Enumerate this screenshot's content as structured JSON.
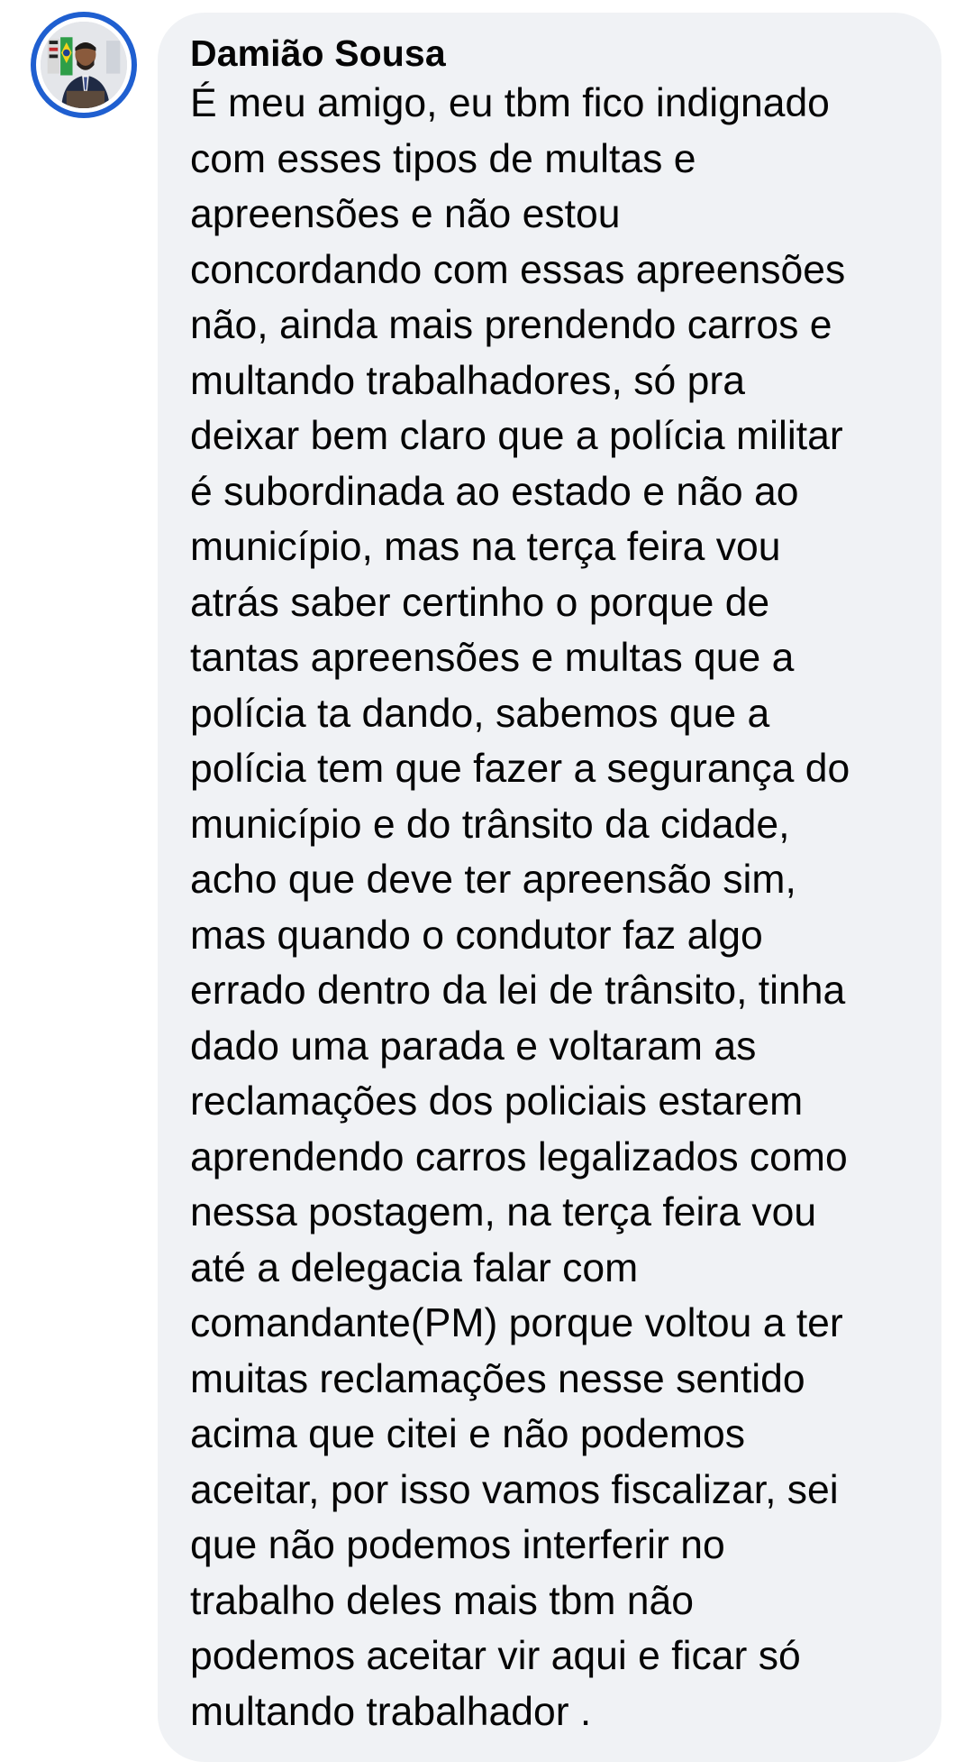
{
  "comment": {
    "author": "Damião Sousa",
    "avatar_icon": "profile-photo",
    "text_lines": [
      "É meu amigo, eu tbm fico indignado",
      "com esses tipos de multas e",
      "apreensões e não estou",
      "concordando com essas apreensões",
      "não, ainda mais prendendo carros e",
      "multando trabalhadores, só pra",
      "deixar bem claro que a polícia militar",
      "é subordinada ao estado e não ao",
      "município, mas na terça feira vou",
      "atrás saber certinho o porque de",
      "tantas apreensões e multas que a",
      "polícia ta dando, sabemos que a",
      "polícia tem que fazer a segurança do",
      "município e do trânsito da cidade,",
      "acho que deve ter apreensão sim,",
      "mas quando o condutor faz algo",
      "errado dentro da lei de trânsito, tinha",
      "dado uma parada e voltaram as",
      "reclamações dos policiais estarem",
      "aprendendo carros legalizados como",
      "nessa postagem, na terça feira vou",
      "até a delegacia falar com",
      "comandante(PM) porque voltou a ter",
      "muitas reclamações nesse sentido",
      "acima que citei e não podemos",
      "aceitar, por isso vamos fiscalizar, sei",
      "que não podemos interferir no",
      "trabalho deles mais tbm não",
      "podemos aceitar vir aqui e ficar só",
      "multando trabalhador ."
    ]
  },
  "colors": {
    "bubble_bg": "#f0f2f5",
    "avatar_ring": "#1f5fd0",
    "text": "#050505"
  }
}
